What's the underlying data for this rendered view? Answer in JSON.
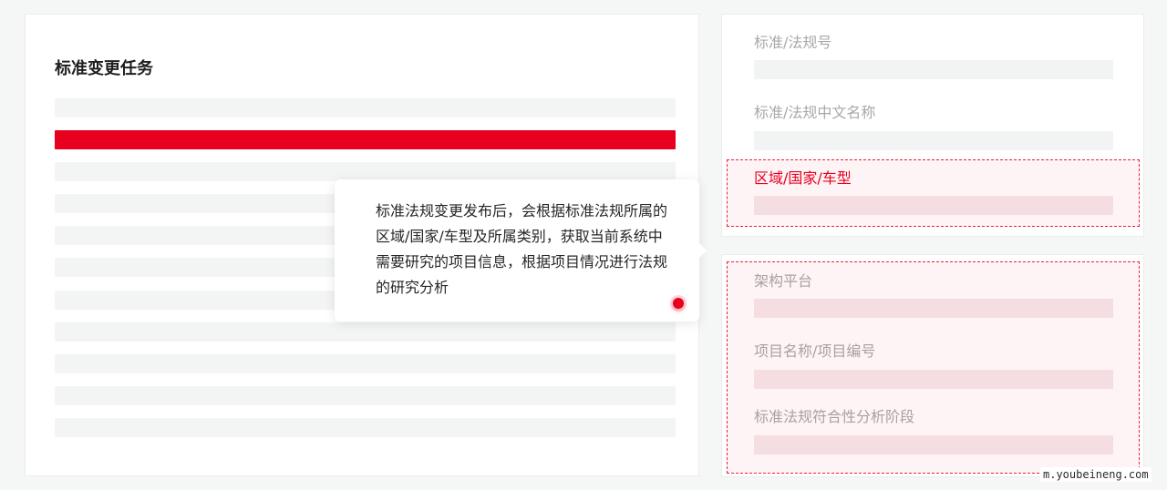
{
  "task_panel": {
    "title": "标准变更任务",
    "row_count": 11,
    "active_row_index": 1
  },
  "tooltip": {
    "text": "标准法规变更发布后，会根据标准法规所属的区域/国家/车型及所属类别，获取当前系统中需要研究的项目信息，根据项目情况进行法规的研究分析"
  },
  "fields_top": {
    "standard_no": "标准/法规号",
    "standard_cn_name": "标准/法规中文名称",
    "region_country_model": "区域/国家/车型"
  },
  "fields_bottom": {
    "platform": "架构平台",
    "project_name_no": "项目名称/项目编号",
    "compliance_stage": "标准法规符合性分析阶段"
  },
  "watermark": "m.youbeineng.com",
  "colors": {
    "accent": "#e8001f",
    "placeholder": "#f3f4f4",
    "label": "#a8a8a8"
  }
}
